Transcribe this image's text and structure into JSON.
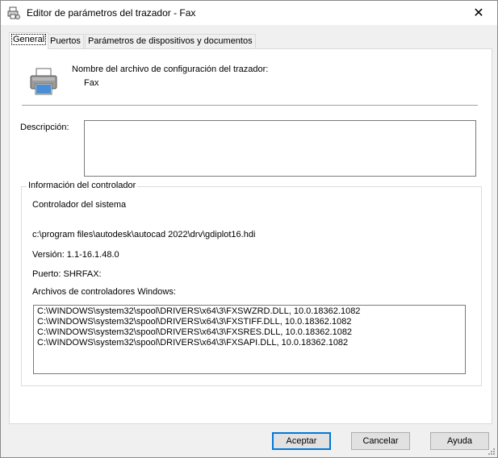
{
  "window": {
    "title": "Editor de parámetros del trazador - Fax",
    "close_symbol": "✕"
  },
  "tabs": [
    {
      "label": "General",
      "active": true
    },
    {
      "label": "Puertos",
      "active": false
    },
    {
      "label": "Parámetros de dispositivos y documentos",
      "active": false
    }
  ],
  "general": {
    "config_file_label": "Nombre del archivo de configuración del trazador:",
    "config_file_name": "Fax",
    "description_label": "Descripción:",
    "description_value": "",
    "driver_group_title": "Información del controlador",
    "driver_name": "Controlador del sistema",
    "driver_path": "c:\\program files\\autodesk\\autocad 2022\\drv\\gdiplot16.hdi",
    "version_line": "Versión: 1.1-16.1.48.0",
    "port_line": "Puerto: SHRFAX:",
    "windows_drivers_label": "Archivos de controladores Windows:",
    "driver_files": [
      "C:\\WINDOWS\\system32\\spool\\DRIVERS\\x64\\3\\FXSWZRD.DLL, 10.0.18362.1082",
      "C:\\WINDOWS\\system32\\spool\\DRIVERS\\x64\\3\\FXSTIFF.DLL, 10.0.18362.1082",
      "C:\\WINDOWS\\system32\\spool\\DRIVERS\\x64\\3\\FXSRES.DLL, 10.0.18362.1082",
      "C:\\WINDOWS\\system32\\spool\\DRIVERS\\x64\\3\\FXSAPI.DLL, 10.0.18362.1082"
    ]
  },
  "buttons": {
    "accept": "Aceptar",
    "cancel": "Cancelar",
    "help": "Ayuda"
  },
  "icons": {
    "title": "plotter-settings-icon",
    "printer": "printer-icon",
    "close": "close-icon"
  }
}
